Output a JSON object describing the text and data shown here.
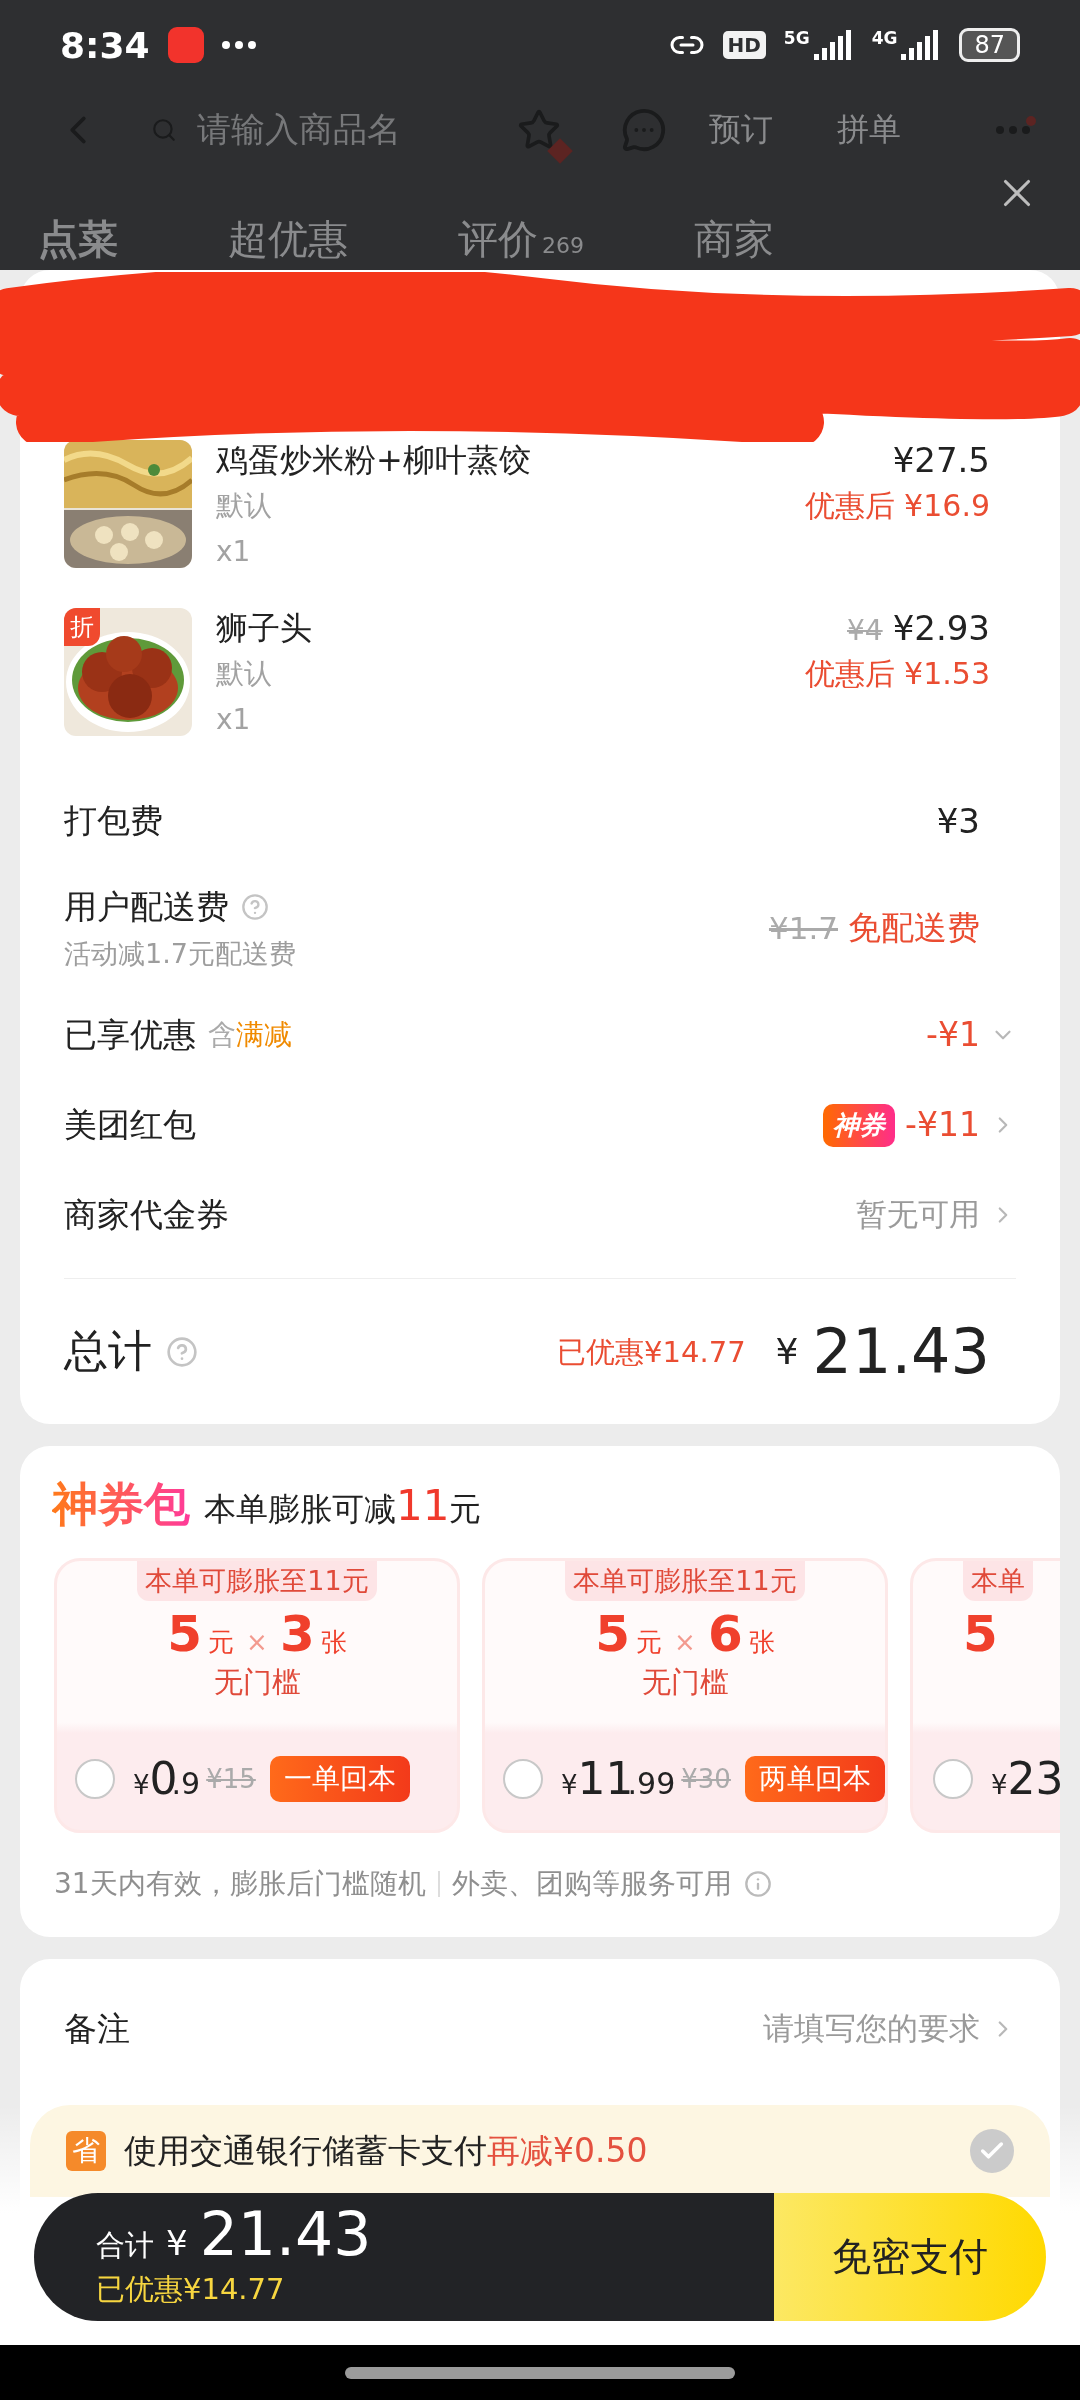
{
  "status_bar": {
    "time": "8:34",
    "hd_label": "HD",
    "networks": [
      "5G",
      "4G"
    ],
    "battery": "87"
  },
  "nav": {
    "search_placeholder": "请输入商品名",
    "actions": [
      "预订",
      "拼单"
    ]
  },
  "tabs": [
    {
      "label": "点菜",
      "selected": true
    },
    {
      "label": "超优惠",
      "selected": false
    },
    {
      "label": "评价",
      "count": "269",
      "selected": false
    },
    {
      "label": "商家",
      "selected": false
    }
  ],
  "items": [
    {
      "name": "鸡蛋炒米粉+柳叶蒸饺",
      "spec": "默认",
      "qty": "x1",
      "price": "¥27.5",
      "discounted": "优惠后 ¥16.9"
    },
    {
      "name": "狮子头",
      "spec": "默认",
      "qty": "x1",
      "original_price": "¥4",
      "price": "¥2.93",
      "discounted": "优惠后 ¥1.53",
      "badge": "折"
    }
  ],
  "fees": [
    {
      "kind": "plain",
      "label": "打包费",
      "value": "¥3"
    },
    {
      "kind": "delivery",
      "label": "用户配送费",
      "note": "活动减1.7元配送费",
      "struck": "¥1.7",
      "value": "免配送费"
    },
    {
      "kind": "discount",
      "label": "已享优惠",
      "tag_prefix": "含",
      "tag": "满减",
      "value": "-¥1"
    },
    {
      "kind": "redpacket",
      "label": "美团红包",
      "badge": "神券",
      "value": "-¥11"
    },
    {
      "kind": "voucher",
      "label": "商家代金券",
      "value": "暂无可用"
    }
  ],
  "total": {
    "label": "总计",
    "saved": "已优惠¥14.77",
    "currency": "¥",
    "amount": "21.43"
  },
  "coupon_pack": {
    "title": "神券包",
    "subtitle_before": "本单膨胀可减",
    "subtitle_highlight": "11",
    "subtitle_after": "元",
    "packs": [
      {
        "kind": "full",
        "ribbon": "本单可膨胀至11元",
        "amount": "5",
        "unit": "元",
        "times": "×",
        "count": "3",
        "count_unit": "张",
        "condition": "无门槛",
        "currency": "¥",
        "price_int": "0",
        "price_dec": ".9",
        "original": "¥15",
        "tag": "一单回本",
        "selected": false
      },
      {
        "kind": "full",
        "ribbon": "本单可膨胀至11元",
        "amount": "5",
        "unit": "元",
        "times": "×",
        "count": "6",
        "count_unit": "张",
        "condition": "无门槛",
        "currency": "¥",
        "price_int": "11",
        "price_dec": ".99",
        "original": "¥30",
        "tag": "两单回本",
        "selected": false
      },
      {
        "kind": "partial",
        "ribbon": "本单",
        "amount": "5",
        "currency": "¥",
        "price_int": "23",
        "selected": false
      }
    ],
    "notes": [
      "31天内有效，膨胀后门槛随机",
      "外卖、团购等服务可用"
    ]
  },
  "remark": {
    "label": "备注",
    "value": "请填写您的要求"
  },
  "bank_offer": {
    "icon_char": "省",
    "text": "使用交通银行储蓄卡支付",
    "highlight": "再减¥0.50",
    "checked": false
  },
  "checkout": {
    "label": "合计",
    "currency": "¥",
    "amount": "21.43",
    "saved": "已优惠¥14.77",
    "pay_button": "免密支付"
  }
}
